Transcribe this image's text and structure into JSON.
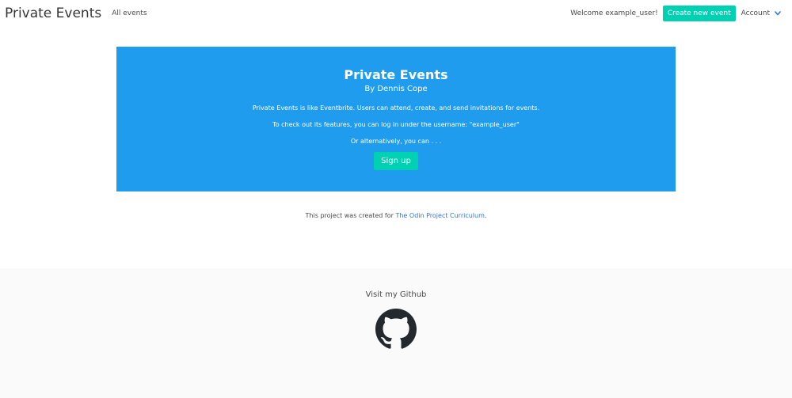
{
  "navbar": {
    "brand": "Private Events",
    "all_events_label": "All events",
    "welcome_text": "Welcome example_user!",
    "create_event_label": "Create new event",
    "account_label": "Account"
  },
  "hero": {
    "title": "Private Events",
    "subtitle": "By Dennis Cope",
    "paragraphs": [
      "Private Events is like Eventbrite. Users can attend, create, and send invitations for events.",
      "To check out its features, you can log in under the username: \"example_user\"",
      "Or alternatively, you can . . ."
    ],
    "signup_label": "Sign up"
  },
  "credit": {
    "prefix": "This project was created for ",
    "link_text": "The Odin Project Curriculum",
    "suffix": "."
  },
  "footer": {
    "text": "Visit my Github"
  },
  "colors": {
    "primary": "#00d1b2",
    "hero_bg": "#209cee",
    "link": "#3273dc",
    "footer_bg": "#fafafa"
  },
  "icons": {
    "account_chevron": "chevron-down-icon",
    "github": "github-icon"
  }
}
